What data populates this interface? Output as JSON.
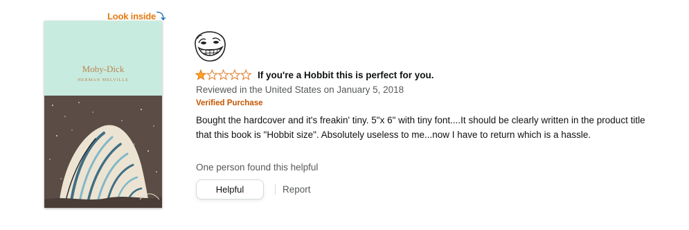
{
  "look_inside": {
    "label": "Look inside",
    "arrow": "⤵"
  },
  "book": {
    "title": "Moby-Dick",
    "author": "HERMAN MELVILLE",
    "cover_colors": {
      "top": "#c8ebe0",
      "bottom": "#5b4c45",
      "text": "#b7864f"
    }
  },
  "review": {
    "avatar_icon": "trollface-avatar-icon",
    "rating": 1,
    "rating_max": 5,
    "star_color": "#ffa41c",
    "headline": "If you're a Hobbit this is perfect for you.",
    "reviewed_line": "Reviewed in the United States on January 5, 2018",
    "badge": "Verified Purchase",
    "body": "Bought the hardcover and it's freakin' tiny. 5\"x 6\" with tiny font....It should be clearly written in the product title that this book is \"Hobbit size\". Absolutely useless to me...now I have to return which is a hassle.",
    "helpful_count": "One person found this helpful",
    "helpful_button": "Helpful",
    "report_link": "Report"
  }
}
